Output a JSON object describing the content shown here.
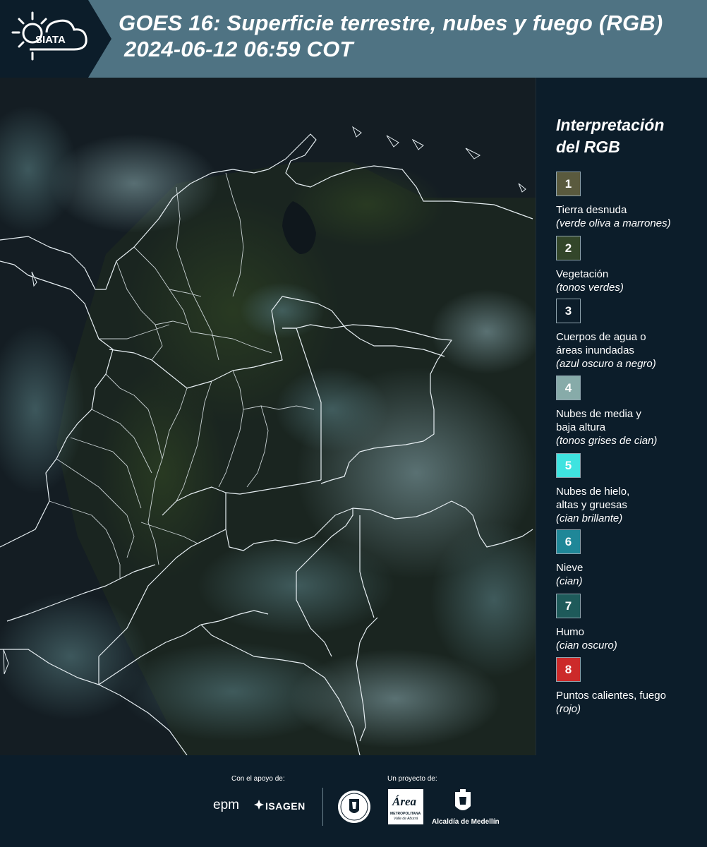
{
  "header": {
    "logo_text": "SIATA",
    "title_line1": "GOES 16: Superficie terrestre, nubes y fuego (RGB)",
    "title_line2": "2024-06-12 06:59 COT"
  },
  "legend": {
    "title_line1": "Interpretación",
    "title_line2": "del RGB",
    "items": [
      {
        "num": "1",
        "color": "#5a5a3e",
        "lines": [
          "Tierra desnuda"
        ],
        "sub": "(verde oliva a marrones)"
      },
      {
        "num": "2",
        "color": "#33462a",
        "lines": [
          "Vegetación"
        ],
        "sub": "(tonos verdes)"
      },
      {
        "num": "3",
        "color": "#0c1d2a",
        "lines": [
          "Cuerpos de agua o",
          "áreas inundadas"
        ],
        "sub": "(azul oscuro a negro)"
      },
      {
        "num": "4",
        "color": "#87aba9",
        "lines": [
          "Nubes de media y",
          "baja altura"
        ],
        "sub": "(tonos grises de cian)"
      },
      {
        "num": "5",
        "color": "#3fe3e0",
        "lines": [
          "Nubes de hielo,",
          "altas y gruesas"
        ],
        "sub": "(cian brillante)"
      },
      {
        "num": "6",
        "color": "#1f8798",
        "lines": [
          "Nieve"
        ],
        "sub": "(cian)"
      },
      {
        "num": "7",
        "color": "#1e5a5a",
        "lines": [
          "Humo"
        ],
        "sub": "(cian oscuro)"
      },
      {
        "num": "8",
        "color": "#cc2a2a",
        "lines": [
          "Puntos calientes, fuego"
        ],
        "sub": "(rojo)"
      }
    ]
  },
  "footer": {
    "support_label": "Con el apoyo de:",
    "project_label": "Un proyecto de:",
    "logos": {
      "epm": "epm",
      "isagen": "ISAGEN",
      "area": "Área",
      "area_sub": "METROPOLITANA",
      "area_sub2": "Valle de Aburrá",
      "alcaldia": "Alcaldía de Medellín"
    }
  }
}
